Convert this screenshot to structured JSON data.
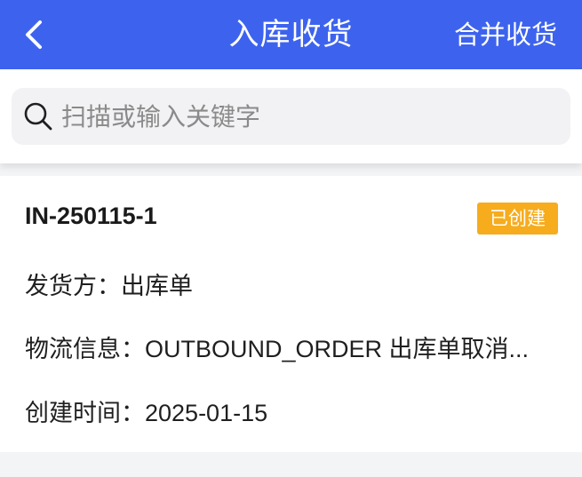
{
  "header": {
    "title": "入库收货",
    "merge_label": "合并收货"
  },
  "search": {
    "placeholder": "扫描或输入关键字",
    "value": ""
  },
  "order": {
    "number": "IN-250115-1",
    "status": "已创建",
    "shipper_label": "发货方：",
    "shipper_value": "出库单",
    "logistics_label": "物流信息：",
    "logistics_value": "OUTBOUND_ORDER 出库单取消...",
    "created_label": "创建时间：",
    "created_value": "2025-01-15"
  },
  "colors": {
    "header_bg": "#3d63ee",
    "badge_bg": "#f6ac1d",
    "page_bg": "#f3f4f6"
  },
  "icons": {
    "back": "chevron-left-icon",
    "search": "search-icon"
  }
}
